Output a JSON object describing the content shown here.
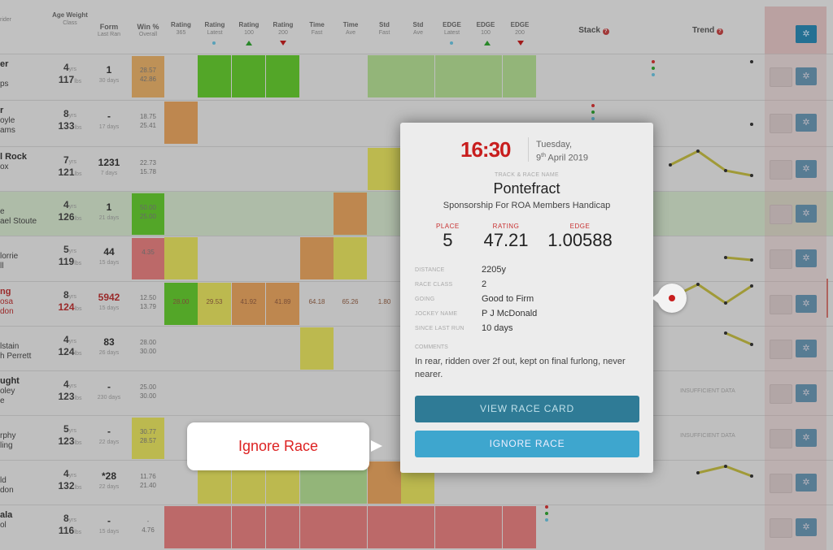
{
  "header": {
    "columns": [
      {
        "id": "horse",
        "top": "",
        "sub": "rider"
      },
      {
        "id": "age",
        "top": "Age Weight",
        "sub": "Class"
      },
      {
        "id": "form",
        "top": "Form",
        "sub": "Last Ran"
      },
      {
        "id": "win",
        "top": "Win %",
        "sub": "Overall"
      },
      {
        "id": "r365",
        "top": "Rating",
        "sub": "365"
      },
      {
        "id": "rlatest",
        "top": "Rating",
        "sub": "Latest"
      },
      {
        "id": "r100",
        "top": "Rating",
        "sub": "100"
      },
      {
        "id": "r200",
        "top": "Rating",
        "sub": "200"
      },
      {
        "id": "tfast",
        "top": "Time",
        "sub": "Fast"
      },
      {
        "id": "tave",
        "top": "Time",
        "sub": "Ave"
      },
      {
        "id": "sfast",
        "top": "Std",
        "sub": "Fast"
      },
      {
        "id": "save",
        "top": "Std",
        "sub": "Ave"
      },
      {
        "id": "elatest",
        "top": "EDGE",
        "sub": "Latest"
      },
      {
        "id": "e100",
        "top": "EDGE",
        "sub": "100"
      },
      {
        "id": "e200",
        "top": "EDGE",
        "sub": "200"
      }
    ],
    "stack_label": "Stack",
    "trend_label": "Trend"
  },
  "rows": [
    {
      "name": "er",
      "badge": "",
      "line2": "",
      "line3": "ps",
      "age": "4",
      "age_unit": "yrs",
      "weight": "117",
      "weight_unit": "lbs",
      "form": "1",
      "last_ran": "30 days",
      "win1": "28.57",
      "win2": "42.86"
    },
    {
      "name": "r",
      "badge": "",
      "line2": "oyle",
      "line3": "ams",
      "age": "8",
      "age_unit": "yrs",
      "weight": "133",
      "weight_unit": "lbs",
      "form": "-",
      "last_ran": "17 days",
      "win1": "18.75",
      "win2": "25.41"
    },
    {
      "name": "l Rock",
      "badge": "",
      "line2": "ox",
      "line3": "",
      "age": "7",
      "age_unit": "yrs",
      "weight": "121",
      "weight_unit": "lbs",
      "form": "1231",
      "last_ran": "7 days",
      "win1": "22.73",
      "win2": "15.78"
    },
    {
      "name": "",
      "badge": "",
      "line2": "e",
      "line3": "ael Stoute",
      "age": "4",
      "age_unit": "yrs",
      "weight": "126",
      "weight_unit": "lbs",
      "form": "1",
      "last_ran": "21 days",
      "win1": "50.00",
      "win2": "25.00"
    },
    {
      "name": "",
      "badge": "",
      "line2": "lorrie",
      "line3": "ll",
      "age": "5",
      "age_unit": "yrs",
      "weight": "119",
      "weight_unit": "lbs",
      "form": "44",
      "last_ran": "15 days",
      "win1": "4.35",
      "win2": ""
    },
    {
      "name": "ng",
      "badge": "",
      "line2": "osa",
      "line3": "don",
      "age": "8",
      "age_unit": "yrs",
      "weight": "124",
      "weight_unit": "lbs",
      "form": "5942",
      "last_ran": "15 days",
      "win1": "12.50",
      "win2": "13.79"
    },
    {
      "name": "",
      "badge": "",
      "line2": "lstain",
      "line3": "h Perrett",
      "age": "4",
      "age_unit": "yrs",
      "weight": "124",
      "weight_unit": "lbs",
      "form": "83",
      "last_ran": "26 days",
      "win1": "28.00",
      "win2": "30.00"
    },
    {
      "name": "ught",
      "badge": "",
      "line2": "oley",
      "line3": "e",
      "age": "4",
      "age_unit": "yrs",
      "weight": "123",
      "weight_unit": "lbs",
      "form": "-",
      "last_ran": "230 days",
      "win1": "25.00",
      "win2": "30.00"
    },
    {
      "name": "",
      "badge": "",
      "line2": "rphy",
      "line3": "ling",
      "age": "5",
      "age_unit": "yrs",
      "weight": "123",
      "weight_unit": "lbs",
      "form": "-",
      "last_ran": "22 days",
      "win1": "30.77",
      "win2": "28.57"
    },
    {
      "name": "",
      "badge": "",
      "line2": "ld",
      "line3": "don",
      "age": "4",
      "age_unit": "yrs",
      "weight": "132",
      "weight_unit": "lbs",
      "form": "*28",
      "last_ran": "22 days",
      "win1": "11.76",
      "win2": "21.40"
    },
    {
      "name": "ala",
      "badge": "",
      "line2": "ol",
      "line3": "",
      "age": "8",
      "age_unit": "yrs",
      "weight": "116",
      "weight_unit": "lbs",
      "form": "-",
      "last_ran": "15 days",
      "win1": "-",
      "win2": "4.76"
    }
  ],
  "row6_cells": [
    "28.00",
    "29.53",
    "41.92",
    "41.89",
    "64.18",
    "65.26",
    "1.80"
  ],
  "insufficient_data": "INSUFFICIENT DATA",
  "popup": {
    "time": "16:30",
    "day": "Tuesday,",
    "date_day": "9",
    "date_suffix": "th",
    "date_rest": " April 2019",
    "track_label": "TRACK & RACE NAME",
    "track": "Pontefract",
    "race_name": "Sponsorship For ROA Members Handicap",
    "place_label": "PLACE",
    "place": "5",
    "rating_label": "RATING",
    "rating": "47.21",
    "edge_label": "EDGE",
    "edge": "1.00588",
    "details": [
      {
        "k": "DISTANCE",
        "v": "2205y"
      },
      {
        "k": "RACE CLASS",
        "v": "2"
      },
      {
        "k": "GOING",
        "v": "Good to Firm"
      },
      {
        "k": "JOCKEY NAME",
        "v": "P J McDonald"
      },
      {
        "k": "SINCE LAST RUN",
        "v": "10 days"
      }
    ],
    "comments_label": "COMMENTS",
    "comments": "In rear, ridden over 2f out, kept on final furlong, never nearer.",
    "view_button": "VIEW RACE CARD",
    "ignore_button": "IGNORE RACE"
  },
  "callout": "Ignore Race",
  "colors": {
    "accent_red": "#c81e1e",
    "button_dark": "#2f7b96",
    "button_light": "#3ea6ce",
    "green": "#5fbe2e",
    "yellow": "#d7d35a",
    "orange": "#d99a5a",
    "red_cell": "#d77878"
  }
}
